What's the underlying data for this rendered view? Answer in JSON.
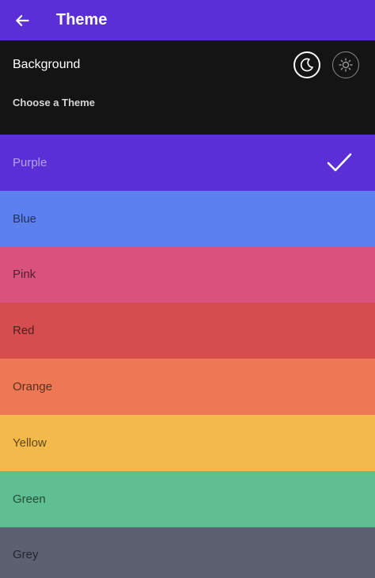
{
  "app_bar": {
    "title": "Theme",
    "color": "#5a2fd6",
    "back_icon": "arrow-left-icon"
  },
  "background": {
    "label": "Background",
    "modes": [
      {
        "name": "dark",
        "icon": "moon-icon",
        "selected": true
      },
      {
        "name": "light",
        "icon": "sun-icon",
        "selected": false
      }
    ]
  },
  "section": {
    "title": "Choose a Theme"
  },
  "themes": [
    {
      "label": "Purple",
      "color": "#5a2fd6",
      "selected": true
    },
    {
      "label": "Blue",
      "color": "#5c80ed"
    },
    {
      "label": "Pink",
      "color": "#d9527d"
    },
    {
      "label": "Red",
      "color": "#d54d4f"
    },
    {
      "label": "Orange",
      "color": "#ed7854"
    },
    {
      "label": "Yellow",
      "color": "#f4b94b"
    },
    {
      "label": "Green",
      "color": "#5fbf92"
    },
    {
      "label": "Grey",
      "color": "#5c6070"
    }
  ],
  "selected_icon": "check-icon"
}
